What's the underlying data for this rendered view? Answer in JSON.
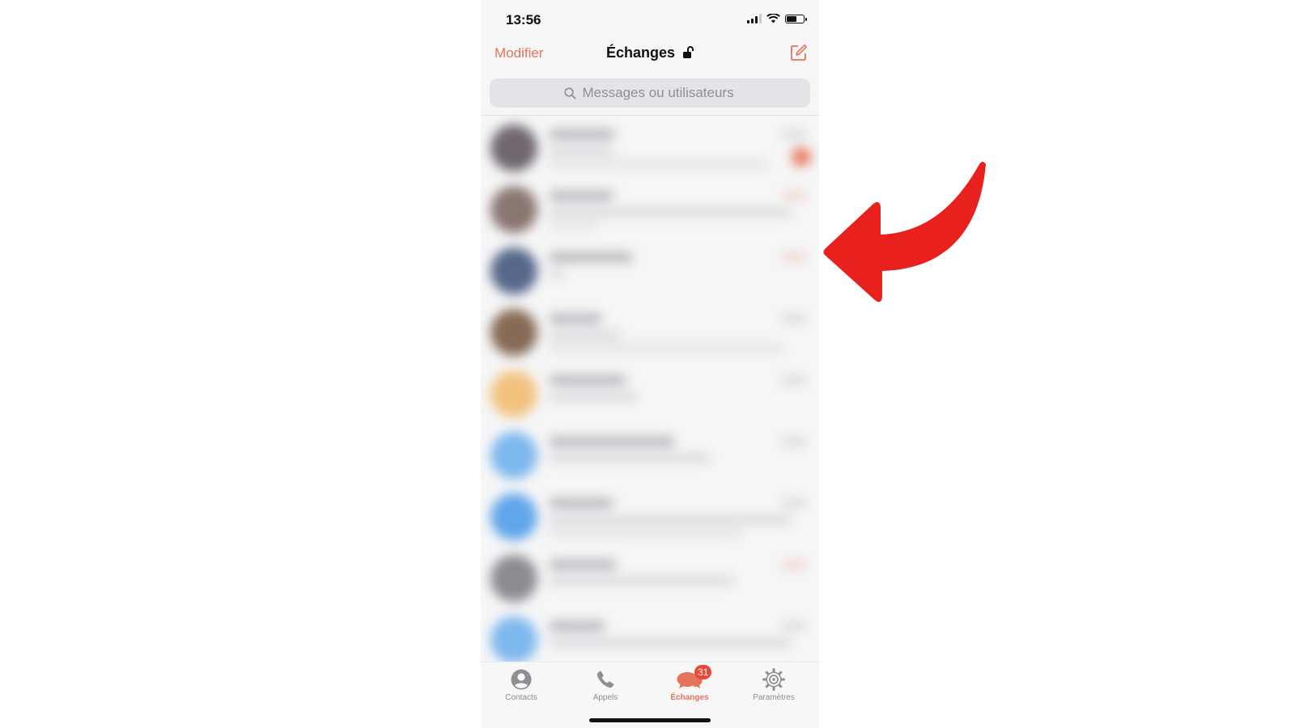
{
  "status_bar": {
    "time": "13:56"
  },
  "nav": {
    "edit_label": "Modifier",
    "title": "Échanges",
    "title_icon": "unlock-icon",
    "compose_icon": "compose-icon"
  },
  "search": {
    "placeholder": "Messages ou utilisateurs"
  },
  "conversations": {
    "content_state": "blurred",
    "visible_rows": 9
  },
  "tabs": [
    {
      "label": "Contacts",
      "icon": "person-icon",
      "active": false
    },
    {
      "label": "Appels",
      "icon": "phone-icon",
      "active": false
    },
    {
      "label": "Échanges",
      "icon": "chat-bubbles-icon",
      "active": true,
      "badge": "31"
    },
    {
      "label": "Paramètres",
      "icon": "gear-icon",
      "active": false
    }
  ],
  "colors": {
    "accent": "#e5735a",
    "badge": "#e84a38",
    "arrow": "#e8211f"
  }
}
